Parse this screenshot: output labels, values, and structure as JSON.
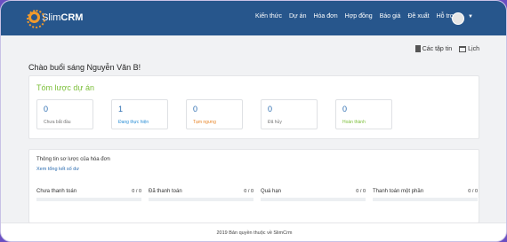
{
  "header": {
    "logo_prefix": "Slim",
    "logo_bold": "CRM",
    "nav": [
      "Kiến thức",
      "Dự án",
      "Hóa đơn",
      "Hợp đồng",
      "Báo giá",
      "Đề xuất",
      "Hỗ trợ"
    ]
  },
  "toolbar": {
    "files_label": "Các tập tin",
    "calendar_label": "Lịch"
  },
  "greeting": "Chào buổi sáng Nguyễn Văn B!",
  "projects": {
    "title": "Tóm lược dự án",
    "stats": [
      {
        "value": "0",
        "label": "Chưa bắt đầu",
        "color": "#777777"
      },
      {
        "value": "1",
        "label": "Đang thực hiện",
        "color": "#2b8fd6"
      },
      {
        "value": "0",
        "label": "Tạm ngưng",
        "color": "#e8862a"
      },
      {
        "value": "0",
        "label": "Đã hủy",
        "color": "#777777"
      },
      {
        "value": "0",
        "label": "Hoàn thành",
        "color": "#7cbf3a"
      }
    ]
  },
  "invoices": {
    "title": "Thông tin sơ lược của hóa đơn",
    "link": "Xem tổng kết số dư",
    "items": [
      {
        "label": "Chưa thanh toán",
        "value": "0 / 0"
      },
      {
        "label": "Đã thanh toán",
        "value": "0 / 0"
      },
      {
        "label": "Quá hạn",
        "value": "0 / 0"
      },
      {
        "label": "Thanh toán một phần",
        "value": "0 / 0"
      }
    ]
  },
  "footer": "2019 Bản quyền thuộc về SlimCrm"
}
